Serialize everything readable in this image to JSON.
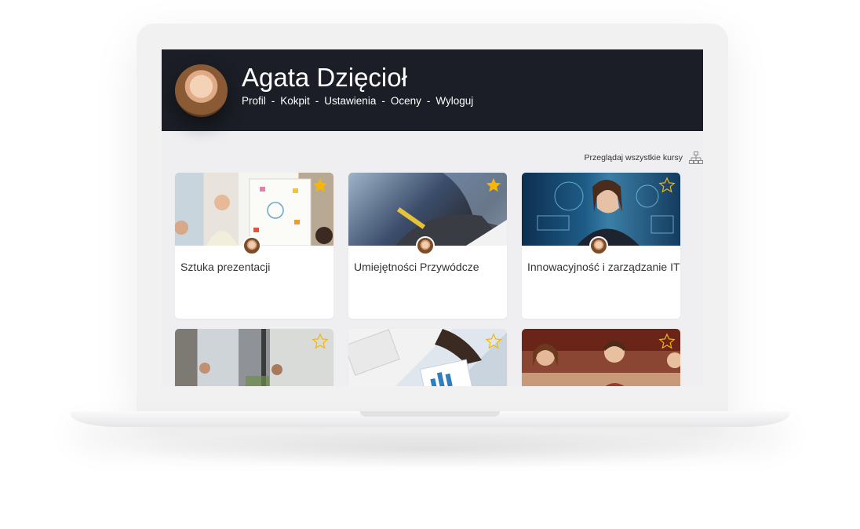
{
  "user": {
    "name": "Agata Dzięcioł"
  },
  "nav": {
    "items": [
      "Profil",
      "Kokpit",
      "Ustawienia",
      "Oceny",
      "Wyloguj"
    ],
    "separator": "-"
  },
  "browse": {
    "label": "Przeglądaj wszystkie kursy",
    "icon": "sitemap-icon"
  },
  "courses": [
    {
      "title": "Sztuka prezentacji",
      "favorite": true
    },
    {
      "title": "Umiejętności Przywódcze",
      "favorite": true
    },
    {
      "title": "Innowacyjność i zarządzanie IT",
      "favorite": false
    },
    {
      "title": "",
      "favorite": false
    },
    {
      "title": "",
      "favorite": false
    },
    {
      "title": "",
      "favorite": false
    }
  ],
  "colors": {
    "header_bg": "#1b1e26",
    "star": "#f5b50a",
    "screen_bg": "#efeff1"
  }
}
